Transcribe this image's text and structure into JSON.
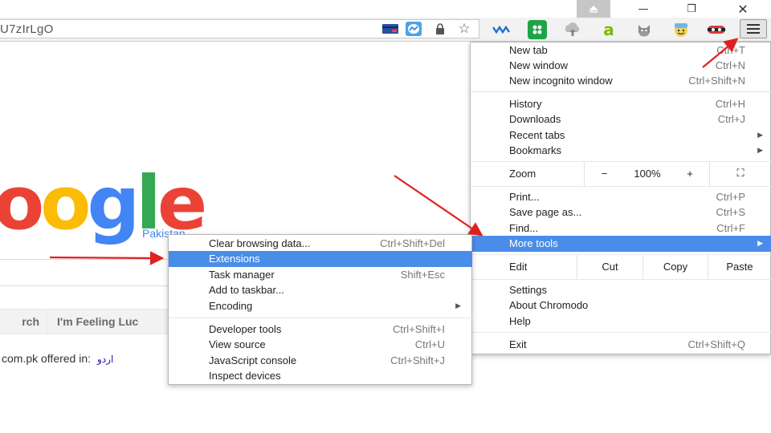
{
  "window": {
    "up_icon": "arrow-up-icon",
    "minimize": "—",
    "maximize": "❐",
    "close": "✕"
  },
  "omnibox": {
    "url": "U7zIrLgO"
  },
  "page": {
    "logo": {
      "o1": "o",
      "o2": "o",
      "g": "g",
      "l": "l",
      "e": "e"
    },
    "country": "Pakistan",
    "search_button": "rch",
    "lucky_button": "I'm Feeling Luc",
    "offered_text": "com.pk offered in:",
    "offered_lang": "اردو"
  },
  "main_menu": {
    "new_tab": {
      "label": "New tab",
      "shortcut": "Ctrl+T"
    },
    "new_window": {
      "label": "New window",
      "shortcut": "Ctrl+N"
    },
    "new_incognito": {
      "label": "New incognito window",
      "shortcut": "Ctrl+Shift+N"
    },
    "history": {
      "label": "History",
      "shortcut": "Ctrl+H"
    },
    "downloads": {
      "label": "Downloads",
      "shortcut": "Ctrl+J"
    },
    "recent_tabs": {
      "label": "Recent tabs"
    },
    "bookmarks": {
      "label": "Bookmarks"
    },
    "zoom": {
      "label": "Zoom",
      "minus": "−",
      "value": "100%",
      "plus": "+",
      "fullscreen": "⛶"
    },
    "print": {
      "label": "Print...",
      "shortcut": "Ctrl+P"
    },
    "save_page": {
      "label": "Save page as...",
      "shortcut": "Ctrl+S"
    },
    "find": {
      "label": "Find...",
      "shortcut": "Ctrl+F"
    },
    "more_tools": {
      "label": "More tools"
    },
    "edit": {
      "label": "Edit",
      "cut": "Cut",
      "copy": "Copy",
      "paste": "Paste"
    },
    "settings": {
      "label": "Settings"
    },
    "about": {
      "label": "About Chromodo"
    },
    "help": {
      "label": "Help"
    },
    "exit": {
      "label": "Exit",
      "shortcut": "Ctrl+Shift+Q"
    }
  },
  "sub_menu": {
    "clear_data": {
      "label": "Clear browsing data...",
      "shortcut": "Ctrl+Shift+Del"
    },
    "extensions": {
      "label": "Extensions"
    },
    "task_manager": {
      "label": "Task manager",
      "shortcut": "Shift+Esc"
    },
    "add_taskbar": {
      "label": "Add to taskbar..."
    },
    "encoding": {
      "label": "Encoding"
    },
    "dev_tools": {
      "label": "Developer tools",
      "shortcut": "Ctrl+Shift+I"
    },
    "view_source": {
      "label": "View source",
      "shortcut": "Ctrl+U"
    },
    "js_console": {
      "label": "JavaScript console",
      "shortcut": "Ctrl+Shift+J"
    },
    "inspect": {
      "label": "Inspect devices"
    }
  },
  "colors": {
    "highlight": "#4a8de8",
    "arrow": "#e02020"
  }
}
